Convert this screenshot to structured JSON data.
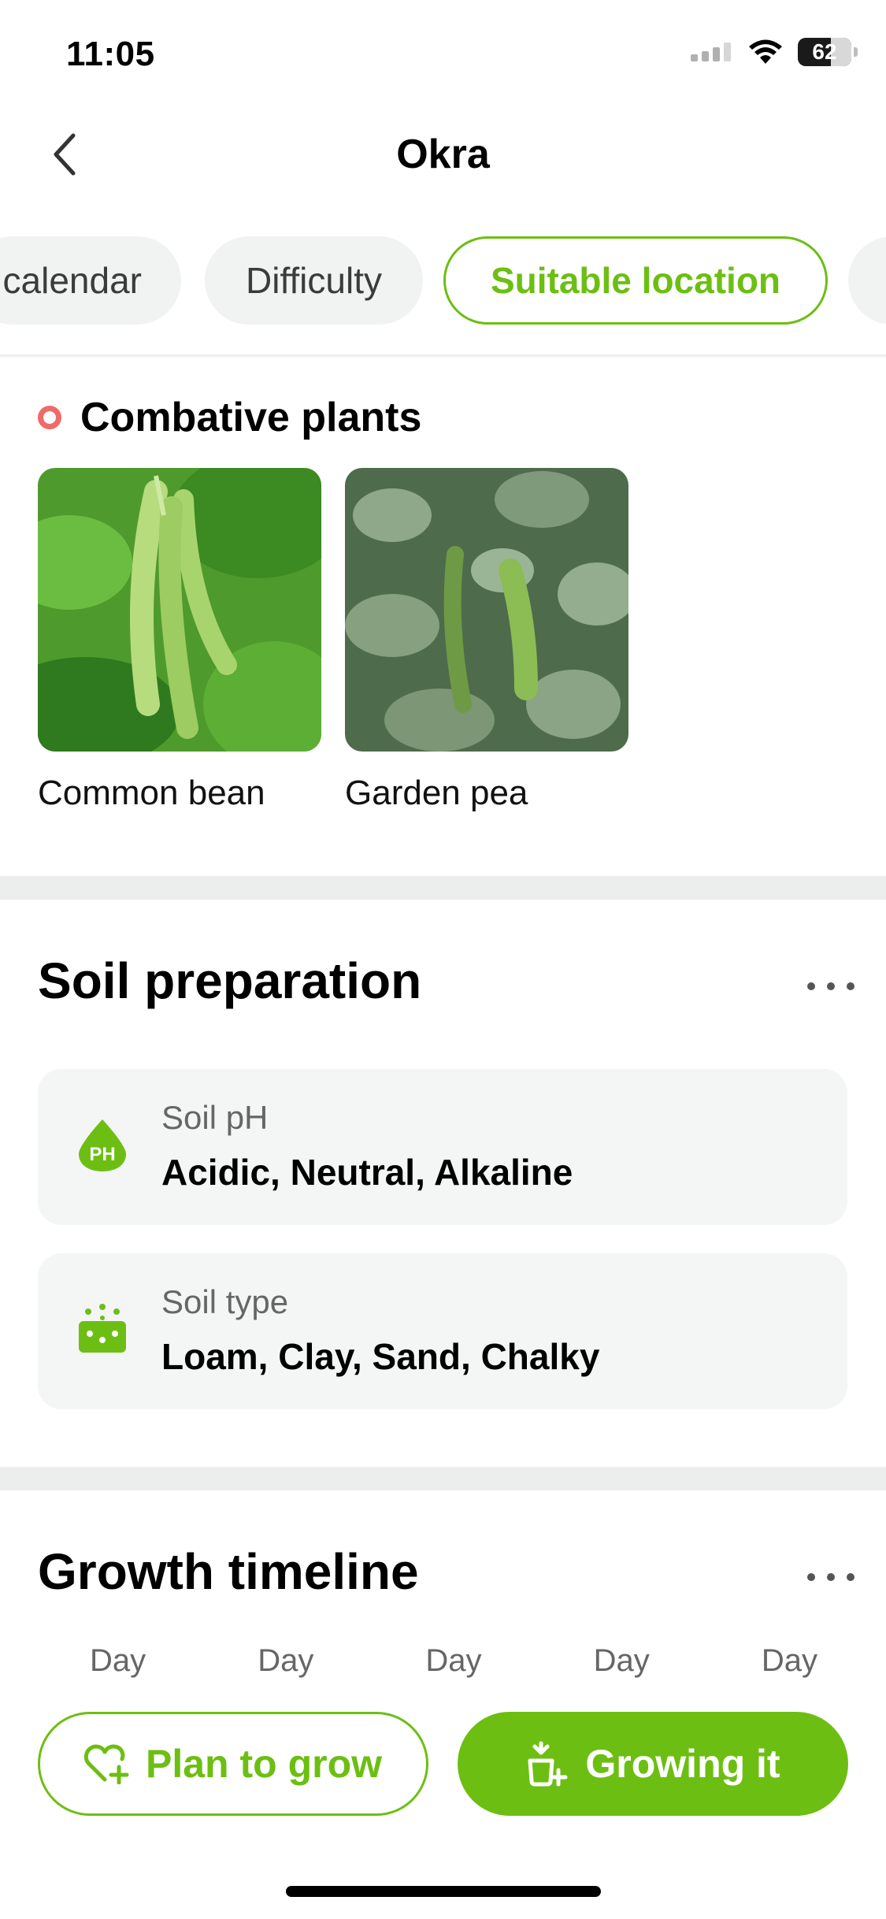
{
  "status_bar": {
    "time": "11:05",
    "battery": "62",
    "battery_fraction": 0.62
  },
  "header": {
    "title": "Okra"
  },
  "tabs": [
    {
      "label": "calendar",
      "active": false
    },
    {
      "label": "Difficulty",
      "active": false
    },
    {
      "label": "Suitable location",
      "active": true
    }
  ],
  "combative": {
    "title": "Combative plants",
    "plants": [
      {
        "name": "Common bean"
      },
      {
        "name": "Garden pea"
      }
    ]
  },
  "soil": {
    "title": "Soil preparation",
    "ph": {
      "icon": "ph-drop-icon",
      "icon_text": "PH",
      "label": "Soil pH",
      "value": "Acidic, Neutral, Alkaline"
    },
    "type": {
      "icon": "soil-icon",
      "label": "Soil type",
      "value": "Loam, Clay, Sand, Chalky"
    }
  },
  "timeline": {
    "title": "Growth timeline",
    "days": [
      "Day",
      "Day",
      "Day",
      "Day",
      "Day"
    ]
  },
  "actions": {
    "plan_label": "Plan to grow",
    "grow_label": "Growing it"
  },
  "colors": {
    "accent": "#6cbf12",
    "dot": "#f06a6a",
    "card_bg": "#f4f6f5"
  }
}
